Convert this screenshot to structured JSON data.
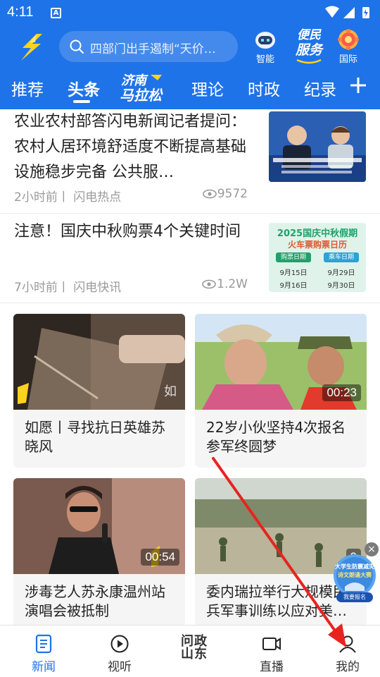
{
  "status_bar": {
    "time": "4:11",
    "notification_letter": "A"
  },
  "header": {
    "search_placeholder": "四部门出手遏制“天价…",
    "buttons": [
      {
        "label": "智能",
        "icon": "robot-icon"
      },
      {
        "label": "服务",
        "icon": "service-icon",
        "badge_text": "便民"
      },
      {
        "label": "国际",
        "icon": "globe-flower-icon"
      }
    ]
  },
  "tabs": {
    "items": [
      "推荐",
      "头条",
      "理论",
      "时政",
      "纪录"
    ],
    "active": "头条",
    "special_logo_text": "济南马拉松"
  },
  "articles": [
    {
      "title": "农业农村部答闪电新闻记者提问：农村人居环境舒适度不断提高基础设施稳步完备 公共服…",
      "meta": "2小时前丨 闪电热点",
      "views": "9572"
    },
    {
      "title": "注意！国庆中秋购票4个关键时间",
      "meta": "7小时前丨 闪电快讯",
      "views": "1.2W",
      "thumb": {
        "title": "2025国庆中秋假期",
        "subtitle": "火车票购票日历",
        "col1": "购票日期",
        "col2": "乘车日期",
        "rows": [
          [
            "9月15日",
            "9月29日"
          ],
          [
            "9月16日",
            "9月30日"
          ]
        ]
      }
    }
  ],
  "videos": [
    {
      "title": "如愿丨寻找抗日英雄苏晓风",
      "duration": ""
    },
    {
      "title": "22岁小伙坚持4次报名参军终圆梦",
      "duration": "00:23"
    },
    {
      "title": "涉毒艺人苏永康温州站演唱会被抵制",
      "duration": "00:54"
    },
    {
      "title": "委内瑞拉举行大规模民兵军事训练以应对美…",
      "duration": "0"
    }
  ],
  "float_ad": {
    "line1": "大学生防震减灾",
    "line2": "诗文朗诵大赛",
    "button": "我要报名"
  },
  "bottom_nav": {
    "items": [
      {
        "label": "新闻",
        "icon": "news-icon"
      },
      {
        "label": "视听",
        "icon": "play-icon"
      },
      {
        "label": "问政山东",
        "icon": "wenzheng-icon"
      },
      {
        "label": "直播",
        "icon": "live-icon"
      },
      {
        "label": "我的",
        "icon": "person-icon"
      }
    ],
    "active": "新闻"
  },
  "colors": {
    "brand": "#1f73e8",
    "annotation_arrow": "#e8231f"
  }
}
